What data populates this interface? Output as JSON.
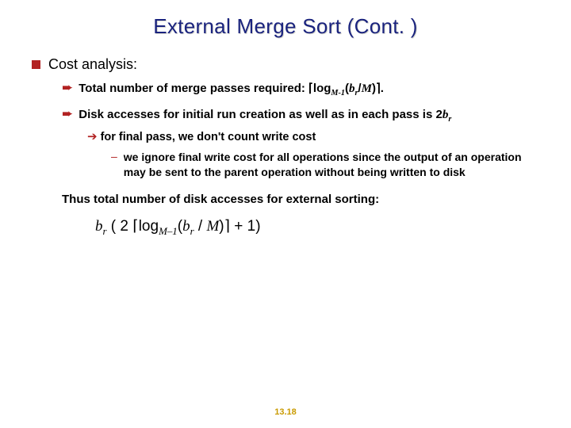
{
  "title": "External Merge Sort (Cont. )",
  "lvl1": {
    "text": "Cost analysis:"
  },
  "lvl2a": {
    "prefix": "Total number of merge passes required: ",
    "ceil_l": "⌈",
    "log": "log",
    "sub": "M-1",
    "open": "(",
    "br": "b",
    "rsub": "r",
    "slash": "/",
    "M": "M",
    "close": ")",
    "ceil_r": "⌉",
    "period": "."
  },
  "lvl2b": {
    "prefix": "Disk accesses for initial run creation as well as in each pass is 2",
    "br": "b",
    "rsub": "r"
  },
  "lvl3a": {
    "text": "for final pass, we don't count write cost"
  },
  "lvl4a": {
    "text": "we ignore final write cost for all operations since the output of an operation may be sent to the parent operation without being written to disk"
  },
  "thus": "Thus total number of disk accesses for external sorting:",
  "formula": {
    "br1": "b",
    "r1": "r",
    "open_p": " ( ",
    "two": "2 ",
    "ceil_l": "⌈",
    "log": "log",
    "sub": "M–1",
    "open": "(",
    "br2": "b",
    "r2": "r",
    "slash": " / ",
    "M": "M",
    "close": ")",
    "ceil_r": "⌉",
    "plus": " + 1)"
  },
  "slideNum": "13.18"
}
